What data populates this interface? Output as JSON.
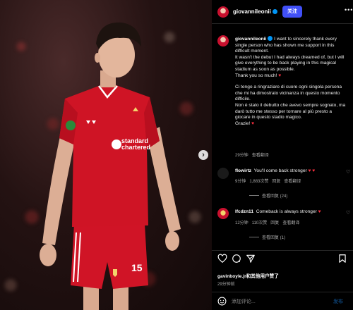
{
  "post": {
    "username": "giovannileonii",
    "follow_label": "关注",
    "more_icon": "more-horizontal-icon",
    "caption_lines": [
      "I want to sincerely thank every single person who has shown me support in this difficult moment.",
      "It wasn't the debut I had always dreamed of, but I will give everything to be back playing in this magical stadium as soon as possible.",
      "Thank you so much!"
    ],
    "caption_italian": [
      "Ci tengo a ringraziare di cuore ogni singola persona che mi ha dimostrato vicinanza in questo momento difficile.",
      "Non è stato il debutto che avevo sempre sognato, ma darò tutto me stesso per tornare al più presto a giocare in questo stadio magico.",
      "Grazie!"
    ],
    "caption_time": "29分钟",
    "caption_translate": "查看翻译",
    "likes_line": "gavinboyle.jr和其他用户赞了",
    "post_time": "29分钟前",
    "add_comment_placeholder": "添加评论...",
    "post_button": "发布"
  },
  "comments": [
    {
      "username": "flowirtz",
      "text": "You'll come back stronger",
      "time": "9分钟",
      "likes": "1,883次赞",
      "reply": "回复",
      "translate": "查看翻译",
      "view_replies": "查看回复 (24)"
    },
    {
      "username": "lfcdzn11",
      "text": "Comeback is always stronger",
      "time": "12分钟",
      "likes": "110次赞",
      "reply": "回复",
      "translate": "查看翻译",
      "view_replies": "查看回复 (1)"
    }
  ],
  "jersey": {
    "sponsor_line1": "standard",
    "sponsor_line2": "chartered",
    "shorts_number": "15"
  },
  "colors": {
    "accent_blue": "#4150f7",
    "liverpool_red": "#c8102e",
    "heart_red": "#ff3040"
  }
}
